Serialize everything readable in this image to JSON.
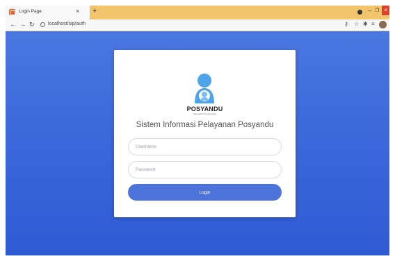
{
  "browser": {
    "tab_title": "Login Page",
    "tab_close": "×",
    "new_tab": "+",
    "url": "localhost/sip/auth",
    "icons": [
      "favicon-icon",
      "back-arrow-icon",
      "forward-arrow-icon",
      "reload-icon",
      "site-info-icon",
      "key-icon",
      "star-icon",
      "extensions-icon",
      "playlist-icon",
      "profile-avatar"
    ],
    "window_controls": {
      "minimize": "–",
      "maximize": "❐",
      "close": "×"
    }
  },
  "login": {
    "brand": "POSYANDU",
    "brand_subtitle": "Kesehatan Ibu dan Anak",
    "app_title": "Sistem Informasi Pelayanan Posyandu",
    "username_placeholder": "Username",
    "password_placeholder": "Password",
    "login_label": "Login"
  },
  "colors": {
    "background": "#3966d9",
    "button": "#4c73d9",
    "logo": "#4fa3e8",
    "tabstrip": "#f3c56b"
  }
}
